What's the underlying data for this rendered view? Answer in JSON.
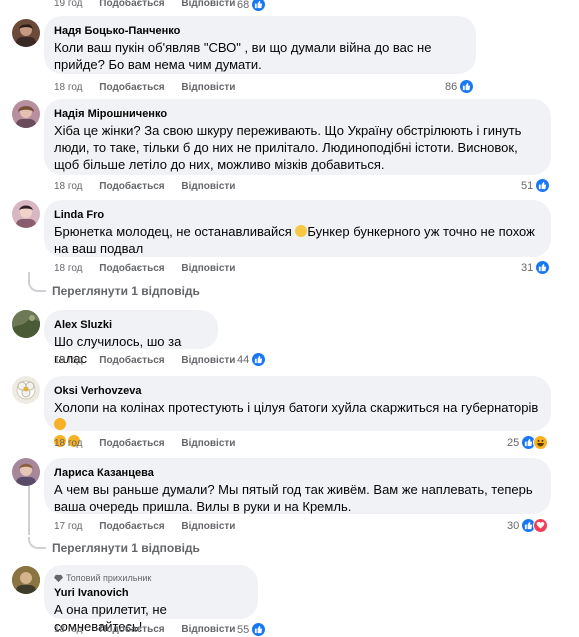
{
  "comments": [
    {
      "author": "Надя Боцько-Панченко",
      "text": "Коли ваш пукін об'являв \"СВО\" , ви що думали війна до вас не прийде? Бо вам нема чим думати.",
      "time": "18 год",
      "like": "Подобається",
      "reply": "Відповісти",
      "reaction_count": "86",
      "avatar_color": "#6b4a3a"
    },
    {
      "author": "Надія Мірошниченко",
      "text": "Хіба це жінки? За свою шкуру переживають. Що Україну обстрілюють і гинуть люди, то таке, тільки б до них не прилітало. Людиноподібні істоти. Висновок, щоб більше летіло до них, можливо мізків добавиться.",
      "time": "18 год",
      "like": "Подобається",
      "reply": "Відповісти",
      "reaction_count": "51",
      "avatar_color": "#a87a8c"
    },
    {
      "author": "Linda Fro",
      "text": "Брюнетка молодец, не останавливайся",
      "text_after_emoji": "Бункер бункерного уж точно не похож на ваш подвал",
      "time": "18 год",
      "like": "Подобається",
      "reply": "Відповісти",
      "reaction_count": "31",
      "avatar_color": "#c9a4b0",
      "view_replies": "Переглянути 1 відповідь"
    },
    {
      "author": "Alex Sluzki",
      "text": "Шо случилось, шо за галас",
      "time": "19 год",
      "like": "Подобається",
      "reply": "Відповісти",
      "reaction_count": "44",
      "avatar_color": "#5d6b4a"
    },
    {
      "author": "Oksi Verhovzeva",
      "text": "Холопи на колінах протестують і цілуя батоги хуйла скаржиться на губернаторів",
      "time": "18 год",
      "like": "Подобається",
      "reply": "Відповісти",
      "reaction_count": "25",
      "avatar_color": "#e8e4d8"
    },
    {
      "author": "Лариса Казанцева",
      "text": "А чем вы раньше думали? Мы пятый год так живём. Вам же наплевать, теперь ваша очередь пришла. Вилы в руки и на Кремль.",
      "time": "17 год",
      "like": "Подобається",
      "reply": "Відповісти",
      "reaction_count": "30",
      "avatar_color": "#9a7a8a",
      "view_replies": "Переглянути 1 відповідь"
    },
    {
      "badge": "Топовий прихильник",
      "author": "Yuri Ivanovich",
      "text": "А она прилетит, не сомневайтесь!",
      "time": "18 год",
      "like": "Подобається",
      "reply": "Відповісти",
      "reaction_count": "55",
      "avatar_color": "#7d6a3e"
    }
  ],
  "top_partial": {
    "time": "19 год",
    "like": "Подобається",
    "reply": "Відповісти",
    "reaction_count": "68"
  },
  "colors": {
    "like": "#1877f2",
    "haha": "#f7b125",
    "love": "#f33e58",
    "bubble": "#f0f2f5",
    "meta": "#65676b"
  }
}
